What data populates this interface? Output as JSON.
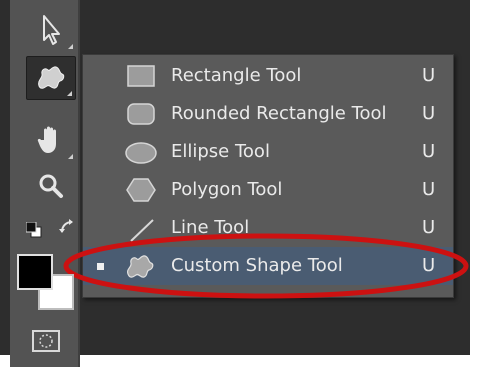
{
  "flyout": {
    "items": [
      {
        "label": "Rectangle Tool",
        "shortcut": "U",
        "icon": "rectangle-icon",
        "selected": false
      },
      {
        "label": "Rounded Rectangle Tool",
        "shortcut": "U",
        "icon": "rounded-rectangle-icon",
        "selected": false
      },
      {
        "label": "Ellipse Tool",
        "shortcut": "U",
        "icon": "ellipse-icon",
        "selected": false
      },
      {
        "label": "Polygon Tool",
        "shortcut": "U",
        "icon": "polygon-icon",
        "selected": false
      },
      {
        "label": "Line Tool",
        "shortcut": "U",
        "icon": "line-icon",
        "selected": false
      },
      {
        "label": "Custom Shape Tool",
        "shortcut": "U",
        "icon": "custom-shape-icon",
        "selected": true
      }
    ]
  },
  "toolbar": {
    "tools": [
      "move-arrow-icon",
      "custom-shape-tool-icon",
      "hand-icon",
      "zoom-icon",
      "swap-colors-icon",
      "foreground-color-swatch",
      "quick-mask-icon"
    ]
  },
  "colors": {
    "foreground": "#000000",
    "background": "#ffffff",
    "highlight": "#cc1111",
    "selected_row": "#4a5c72"
  }
}
